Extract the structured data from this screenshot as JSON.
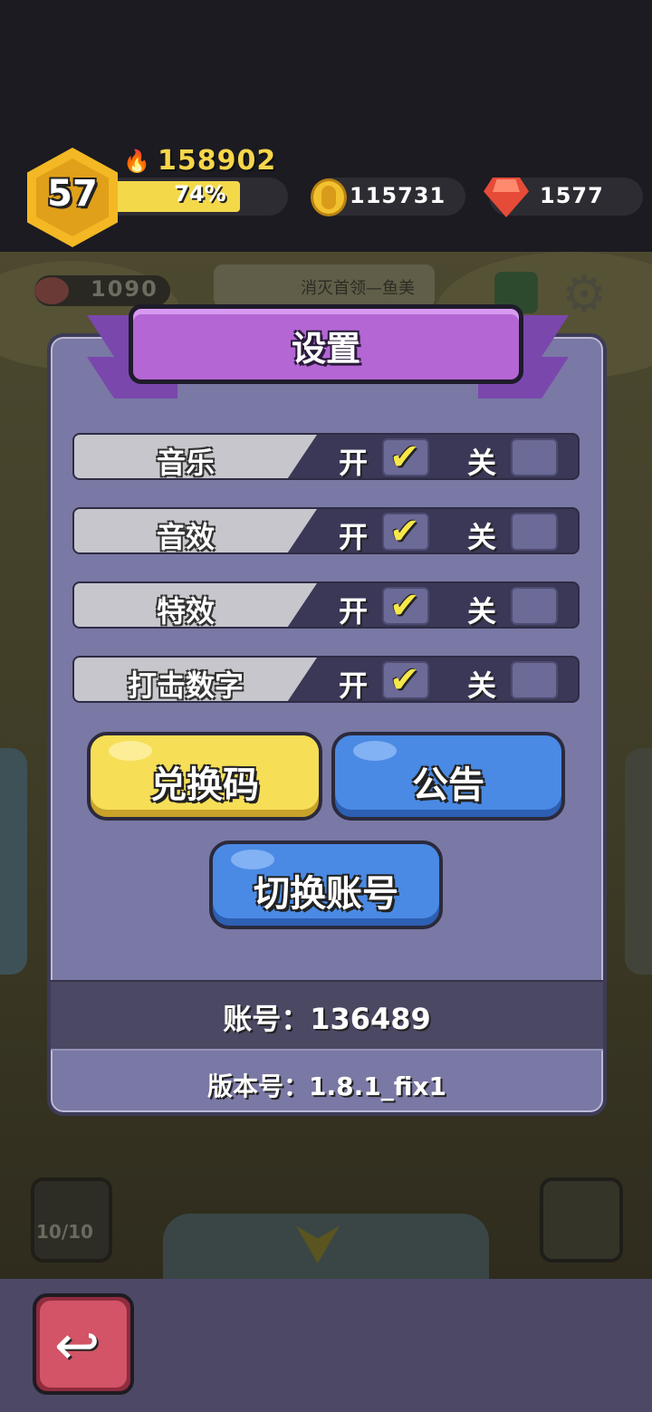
{
  "hud": {
    "level": "57",
    "power": "158902",
    "xp_percent_label": "74%",
    "xp_fraction": 0.74,
    "coins": "115731",
    "gems": "1577"
  },
  "background": {
    "meat_count": "1090",
    "hint_text": "消灭首领—鱼美",
    "slot_left_count": "10/10"
  },
  "dialog": {
    "title": "设置",
    "rows": [
      {
        "label": "音乐",
        "on": "开",
        "off": "关",
        "checked": "on"
      },
      {
        "label": "音效",
        "on": "开",
        "off": "关",
        "checked": "on"
      },
      {
        "label": "特效",
        "on": "开",
        "off": "关",
        "checked": "on"
      },
      {
        "label": "打击数字",
        "on": "开",
        "off": "关",
        "checked": "on"
      }
    ],
    "redeem_label": "兑换码",
    "notice_label": "公告",
    "switch_account_label": "切换账号",
    "account_text": "账号：136489",
    "version_text": "版本号：1.8.1_fix1"
  },
  "icons": {
    "check": "✔",
    "back": "↩",
    "fire": "🔥",
    "gear": "⚙",
    "down": "⮟"
  },
  "colors": {
    "title_purple": "#b466d4",
    "dialog_bg": "#7a78a4",
    "yellow_button": "#f6de57",
    "blue_button": "#4a8ae4",
    "back_button": "#d25466",
    "xp_fill": "#f3d84a"
  }
}
